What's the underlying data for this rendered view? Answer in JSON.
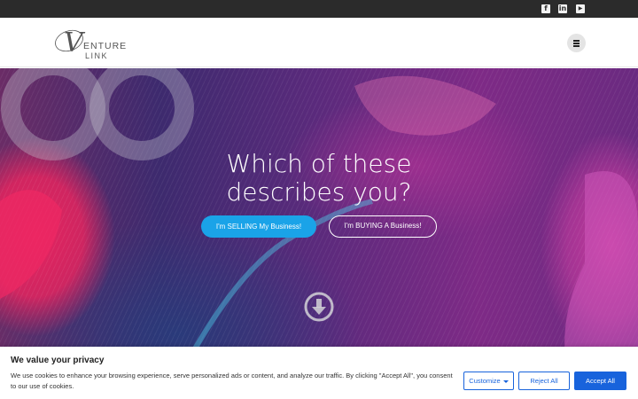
{
  "topbar": {
    "social": [
      {
        "name": "facebook-icon",
        "glyph": "f"
      },
      {
        "name": "linkedin-icon",
        "glyph": "in"
      },
      {
        "name": "youtube-icon",
        "glyph": "▶"
      }
    ]
  },
  "header": {
    "logo": {
      "main": "ENTURE",
      "sub": "LINK",
      "initial": "V"
    }
  },
  "hero": {
    "title_line1": "Which of these",
    "title_line2": "describes you?",
    "sell_button": "I'm SELLING My Business!",
    "buy_button": "I'm BUYING A Business!"
  },
  "cookie": {
    "title": "We value your privacy",
    "text": "We use cookies to enhance your browsing experience, serve personalized ads or content, and analyze our traffic. By clicking \"Accept All\", you consent to our use of cookies.",
    "customize": "Customize",
    "reject": "Reject All",
    "accept": "Accept All"
  },
  "colors": {
    "topbar": "#2b2b2b",
    "sell_button": "#1aa3e8",
    "cookie_accent": "#1863dc"
  }
}
